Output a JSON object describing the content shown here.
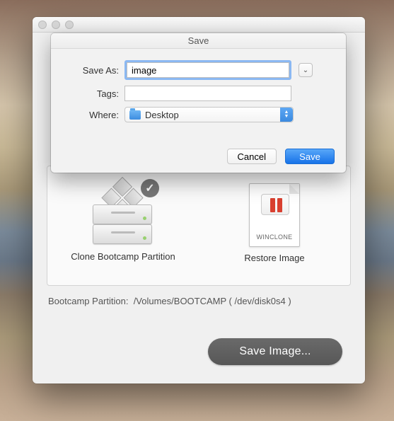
{
  "sheet": {
    "title": "Save",
    "saveas_label": "Save As:",
    "saveas_value": "image",
    "tags_label": "Tags:",
    "tags_value": "",
    "where_label": "Where:",
    "where_value": "Desktop",
    "cancel": "Cancel",
    "save": "Save"
  },
  "tiles": {
    "clone": "Clone Bootcamp Partition",
    "restore": "Restore Image",
    "winclone_badge": "WINCLONE"
  },
  "status": {
    "label": "Bootcamp Partition:",
    "value": "/Volumes/BOOTCAMP ( /dev/disk0s4 )"
  },
  "main_button": "Save Image..."
}
